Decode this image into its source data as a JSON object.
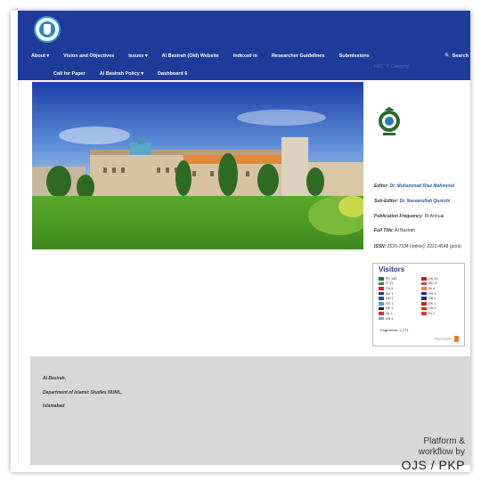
{
  "nav": {
    "row1": [
      "About ▾",
      "Vision and Objectives",
      "Issues ▾",
      "Al Basirah (Old) Website",
      "Indexed in",
      "Researcher Guidelines",
      "Submissions"
    ],
    "row2": [
      "Call for Paper",
      "Al Basirah Policy ▾",
      "Dashboard 6"
    ],
    "search": "🔍 Search"
  },
  "sidebar": {
    "hec_category": "HEC 'Y' Category",
    "editor_label": "Editor:",
    "editor_value": "Dr. Muhammad Riaz Mahmood",
    "subeditor_label": "Sub-Editor:",
    "subeditor_value": "Dr. Naseerullah Qureshi",
    "frequency_label": "Publication Frequency:",
    "frequency_value": "Bi-Annual",
    "fulltitle_label": "Full Title:",
    "fulltitle_value": "Al Basirah",
    "issn_label": "ISSN:",
    "issn_value": "2520-7334 (online); 2222-4548 (print)"
  },
  "visitors": {
    "title": "Visitors",
    "left": [
      {
        "code": "PK",
        "count": "145",
        "color": "#1a7a2e"
      },
      {
        "code": "IT",
        "count": "11",
        "color": "#2e8b3e"
      },
      {
        "code": "CA",
        "count": "4",
        "color": "#d22"
      },
      {
        "code": "AU",
        "count": "1",
        "color": "#1a3a8a"
      },
      {
        "code": "DO",
        "count": "1",
        "color": "#2a4aa0"
      },
      {
        "code": "SO",
        "count": "1",
        "color": "#4aa0e0"
      },
      {
        "code": "DE",
        "count": "1",
        "color": "#222"
      },
      {
        "code": "NL",
        "count": "1",
        "color": "#c33"
      },
      {
        "code": "AR",
        "count": "1",
        "color": "#7ac"
      }
    ],
    "right": [
      {
        "code": "US",
        "count": "23",
        "color": "#b22"
      },
      {
        "code": "MO",
        "count": "4",
        "color": "#c44"
      },
      {
        "code": "IN",
        "count": "4",
        "color": "#e83"
      },
      {
        "code": "PH",
        "count": "1",
        "color": "#22a"
      },
      {
        "code": "GB",
        "count": "1",
        "color": "#236"
      },
      {
        "code": "DK",
        "count": "1",
        "color": "#c22"
      },
      {
        "code": "CN",
        "count": "1",
        "color": "#d22"
      },
      {
        "code": "ID",
        "count": "1",
        "color": "#d33"
      }
    ],
    "pageviews": "Pageviews: 1,271",
    "flag_counter": "Flag Counter"
  },
  "footer": {
    "line1": "Al Basirah,",
    "line2": "Department of Islamic Studies NUML,",
    "line3": "Islamabad",
    "platform1": "Platform &",
    "platform2": "workflow by",
    "pkp": "OJS / PKP"
  }
}
